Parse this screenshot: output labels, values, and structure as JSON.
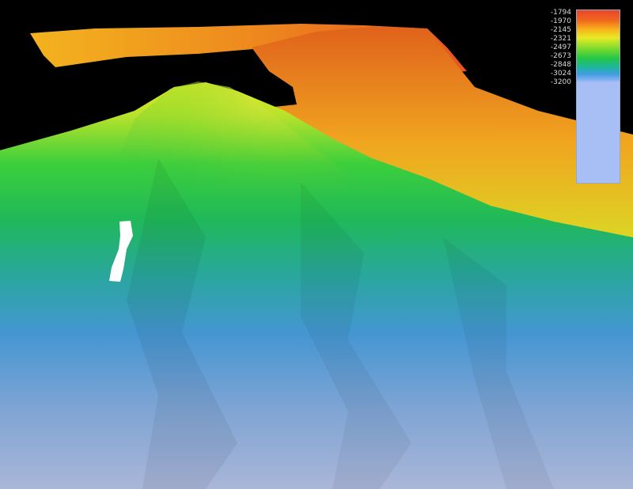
{
  "legend": {
    "labels": [
      "-1794",
      "-1970",
      "-2145",
      "-2321",
      "-2497",
      "-2673",
      "-2848",
      "-3024",
      "-3200"
    ],
    "colors": [
      "#e8452a",
      "#f7b21c",
      "#e8ea24",
      "#22c646",
      "#3f9de0",
      "#a8bff5"
    ]
  },
  "scene": {
    "background": "#000000",
    "marker_color": "#ffffff"
  }
}
